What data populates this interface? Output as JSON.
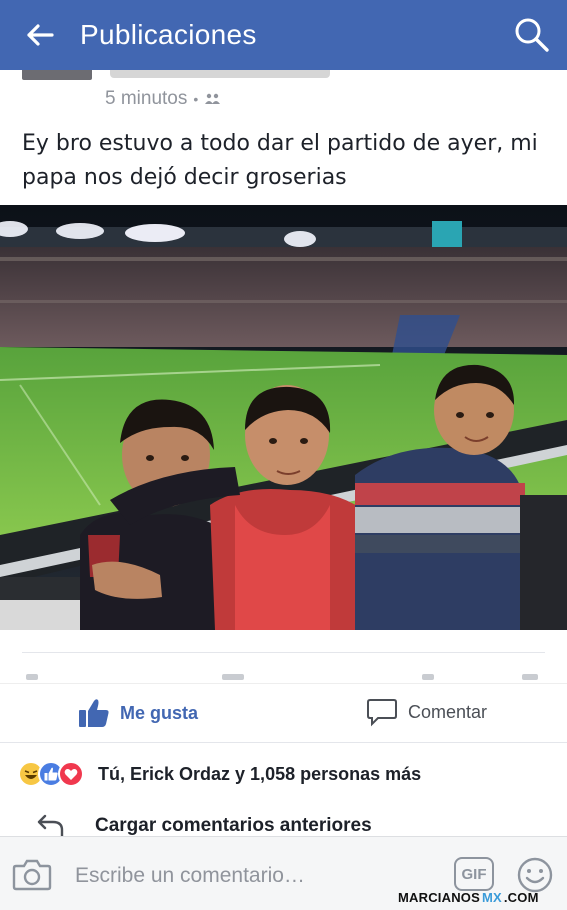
{
  "appbar": {
    "title": "Publicaciones",
    "back_icon": "arrow-left-icon",
    "search_icon": "search-icon",
    "color": "#4267b2"
  },
  "post": {
    "timestamp": "5 minutos",
    "privacy_icon": "friends-icon",
    "text": "Ey bro estuvo a todo dar el partido de ayer, mi papa nos dejó decir groserias"
  },
  "actions": {
    "like_label": "Me gusta",
    "comment_label": "Comentar",
    "like_color": "#4267b2"
  },
  "reactions": {
    "icons": [
      "haha-icon",
      "like-icon",
      "love-icon"
    ],
    "summary": "Tú, Erick Ordaz y 1,058 personas más"
  },
  "comments": {
    "load_more": "Cargar comentarios anteriores"
  },
  "composer": {
    "placeholder": "Escribe un comentario…",
    "gif_label": "GIF"
  },
  "watermark": {
    "text_a": "MARCIANOS",
    "text_b": "MX",
    "text_c": ".COM"
  }
}
